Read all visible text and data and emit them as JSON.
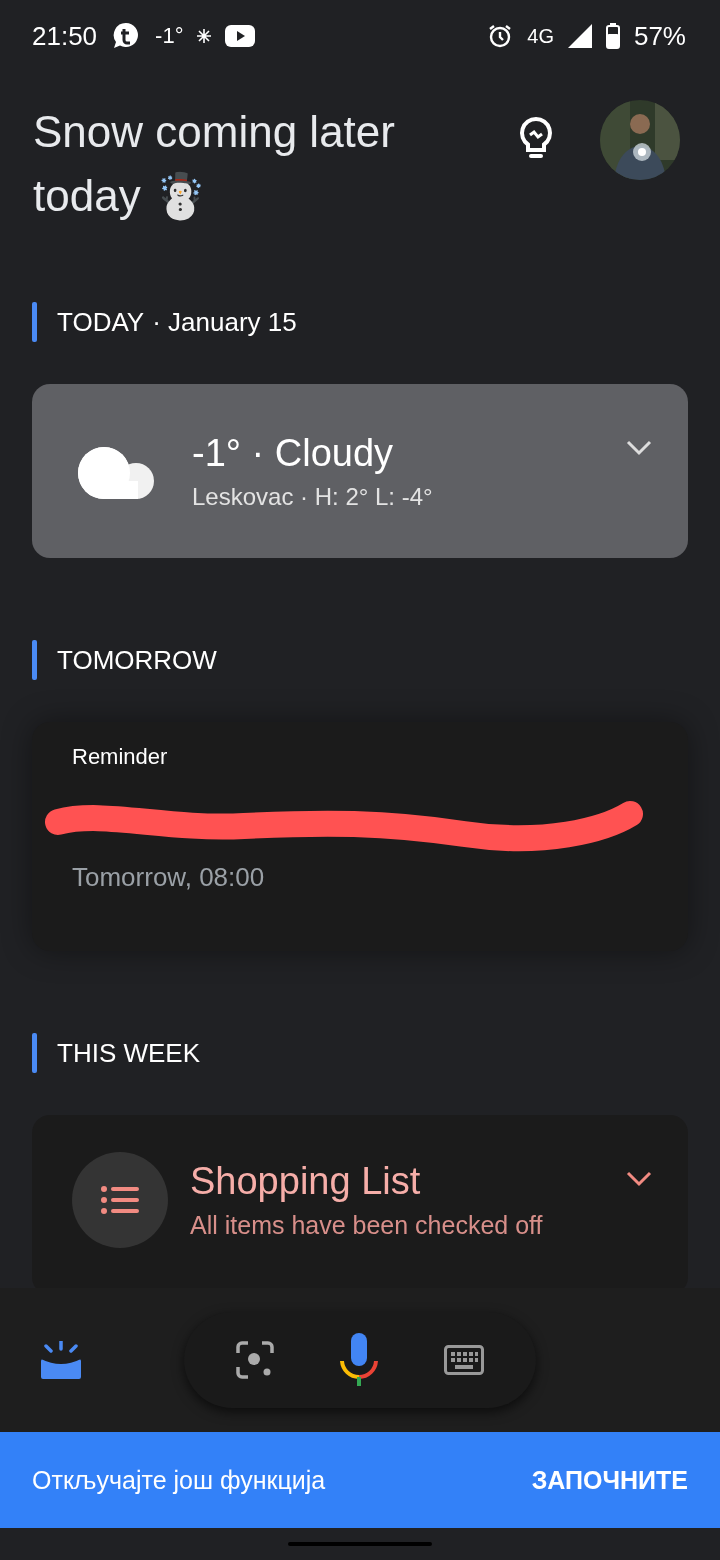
{
  "status_bar": {
    "time": "21:50",
    "temperature": "-1°",
    "network": "4G",
    "battery": "57%"
  },
  "header": {
    "title": "Snow coming later today ☃️"
  },
  "sections": [
    {
      "heading": "TODAY",
      "date": "· January 15",
      "card": {
        "kind": "weather",
        "title": "-1° · Cloudy",
        "subtitle": "Leskovac · H: 2° L: -4°"
      }
    },
    {
      "heading": "TOMORROW",
      "card": {
        "kind": "reminder",
        "label": "Reminder",
        "redacted": true,
        "time": "Tomorrow, 08:00"
      }
    },
    {
      "heading": "THIS WEEK",
      "card": {
        "kind": "list",
        "title": "Shopping List",
        "subtitle": "All items have been checked off"
      }
    }
  ],
  "banner": {
    "text": "Откључајте још функција",
    "action": "ЗАПОЧНИТЕ"
  }
}
